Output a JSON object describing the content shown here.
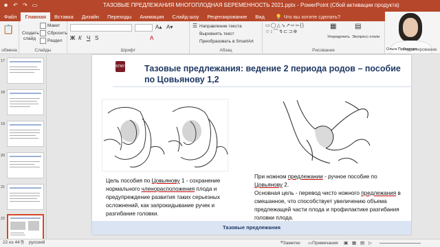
{
  "window": {
    "title": "ТАЗОВЫЕ ПРЕДЛЕЖАНИЯ МНОГОПЛОДНАЯ БЕРЕМЕННОСТЬ 2021.pptx - PowerPoint (Сбой активации продукта)"
  },
  "tabs": [
    {
      "label": "Файл"
    },
    {
      "label": "Главная"
    },
    {
      "label": "Вставка"
    },
    {
      "label": "Дизайн"
    },
    {
      "label": "Переходы"
    },
    {
      "label": "Анимация"
    },
    {
      "label": "Слайд-шоу"
    },
    {
      "label": "Рецензирование"
    },
    {
      "label": "Вид"
    }
  ],
  "tell_me": "Что вы хотите сделать?",
  "ribbon": {
    "slides_group": "Слайды",
    "clipboard_group": "обмена",
    "font_group": "Шрифт",
    "paragraph_group": "Абзац",
    "drawing_group": "Рисование",
    "layout_label": "Макет",
    "reset_label": "Сбросить",
    "section_label": "Раздел",
    "create_slide_label": "Создать слайд",
    "text_direction_label": "Направление текста",
    "align_text_label": "Выровнять текст",
    "smartart_label": "Преобразовать в SmartArt",
    "arrange_label": "Упорядочить",
    "quick_styles_label": "Экспресс-стили",
    "editing_label": "Редактирование"
  },
  "webcam": {
    "name": "Ольга Прохорова"
  },
  "slide": {
    "logo_text": "БГМУ",
    "title": "Тазовые предлежания: ведение 2 периода родов – пособие по Цовьянову 1,2",
    "left_text_parts": [
      "Цель пособия по ",
      "Цовьянову",
      " 1 - сохранение нормального ",
      "членорасположения",
      " плода и предупреждение развития таких серьезных осложнений, как запрокидывание ручек и разгибание головки."
    ],
    "right_text_parts": [
      "При ножном ",
      "предлежании",
      "  - ручное пособие по ",
      "Цовьянову",
      " 2.",
      "Основная цель - перевод чисто ножного ",
      "предлежания",
      " в смешанное, что способствует увеличению объема предлежащей части плода и профилактике разгибания головки плода."
    ],
    "footer": "Тазовые предлежания"
  },
  "thumbnails": [
    {
      "num": "17"
    },
    {
      "num": "18"
    },
    {
      "num": "19"
    },
    {
      "num": "20"
    },
    {
      "num": "21"
    },
    {
      "num": "22"
    },
    {
      "num": "23"
    }
  ],
  "status": {
    "slide_count": "22 из 44",
    "language": "русский",
    "notes": "Заметки",
    "comments": "Примечания"
  },
  "colors": {
    "accent": "#b7472a",
    "title_color": "#1f3864",
    "footer_band": "#dbe4f3"
  }
}
